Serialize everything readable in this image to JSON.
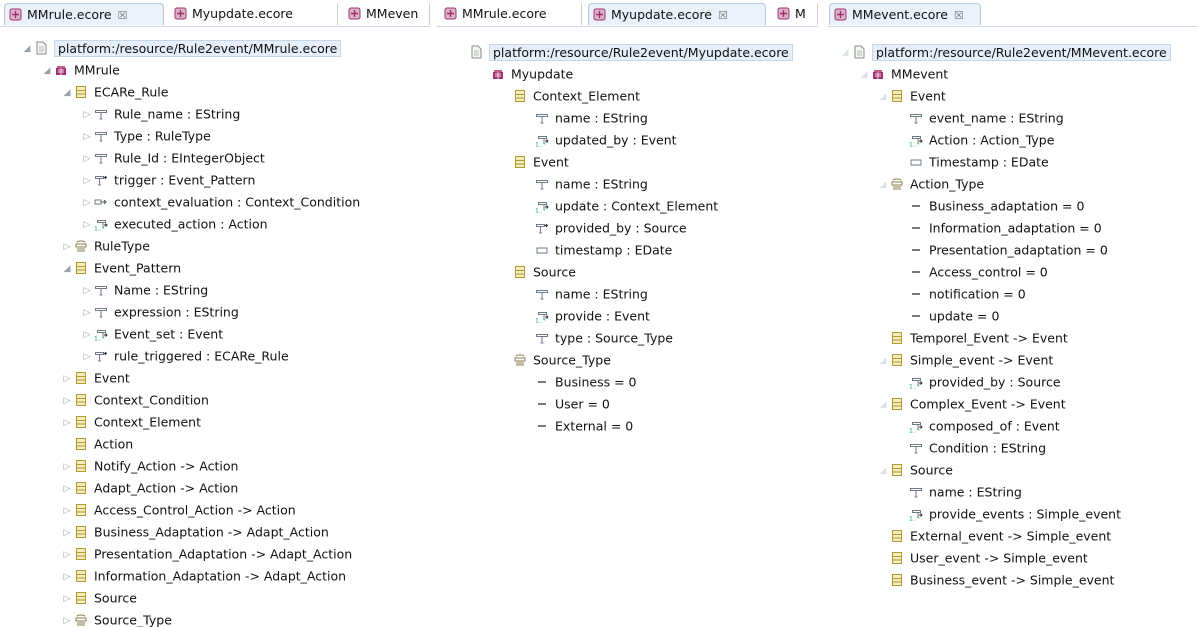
{
  "colors": {
    "package": "#a03070",
    "class": "#b09a30",
    "attr": "#6c7a8a",
    "enum": "#8a7d4d"
  },
  "pane1": {
    "tabs": [
      {
        "label": "MMrule.ecore",
        "close": "☒",
        "active": true
      },
      {
        "label": "Myupdate.ecore",
        "close": "",
        "active": false
      },
      {
        "label": "MMeven",
        "close": "",
        "active": false
      }
    ],
    "rows": [
      {
        "text": "platform:/resource/Rule2event/MMrule.ecore",
        "icon": "resource-file-icon",
        "tw": "open",
        "level": 0
      },
      {
        "text": "MMrule",
        "icon": "package-icon",
        "tw": "open",
        "level": 1
      },
      {
        "text": "ECARe_Rule",
        "icon": "eclass-icon",
        "tw": "open",
        "level": 2
      },
      {
        "text": "Rule_name : EString",
        "icon": "attribute-icon",
        "tw": "closed",
        "level": 3
      },
      {
        "text": "Type : RuleType",
        "icon": "attribute-icon",
        "tw": "closed",
        "level": 3
      },
      {
        "text": "Rule_Id : EIntegerObject",
        "icon": "attribute-icon",
        "tw": "closed",
        "level": 3
      },
      {
        "text": "trigger : Event_Pattern",
        "icon": "reference-icon",
        "tw": "closed",
        "level": 3
      },
      {
        "text": "context_evaluation : Context_Condition",
        "icon": "containment-icon",
        "tw": "closed",
        "level": 3
      },
      {
        "text": "executed_action : Action",
        "icon": "many-reference-icon",
        "tw": "closed",
        "level": 3
      },
      {
        "text": "RuleType",
        "icon": "enum-icon",
        "tw": "closed",
        "level": 2
      },
      {
        "text": "Event_Pattern",
        "icon": "eclass-icon",
        "tw": "open",
        "level": 2
      },
      {
        "text": "Name : EString",
        "icon": "attribute-icon",
        "tw": "closed",
        "level": 3
      },
      {
        "text": "expression : EString",
        "icon": "attribute-icon",
        "tw": "closed",
        "level": 3
      },
      {
        "text": "Event_set : Event",
        "icon": "many-reference-icon",
        "tw": "closed",
        "level": 3
      },
      {
        "text": "rule_triggered : ECARe_Rule",
        "icon": "reference-icon",
        "tw": "closed",
        "level": 3
      },
      {
        "text": "Event",
        "icon": "eclass-icon",
        "tw": "closed",
        "level": 2
      },
      {
        "text": "Context_Condition",
        "icon": "eclass-icon",
        "tw": "closed",
        "level": 2
      },
      {
        "text": "Context_Element",
        "icon": "eclass-icon",
        "tw": "closed",
        "level": 2
      },
      {
        "text": "Action",
        "icon": "eclass-icon",
        "tw": "none",
        "level": 2
      },
      {
        "text": "Notify_Action -> Action",
        "icon": "eclass-icon",
        "tw": "closed",
        "level": 2
      },
      {
        "text": "Adapt_Action -> Action",
        "icon": "eclass-icon",
        "tw": "closed",
        "level": 2
      },
      {
        "text": "Access_Control_Action -> Action",
        "icon": "eclass-icon",
        "tw": "closed",
        "level": 2
      },
      {
        "text": "Business_Adaptation -> Adapt_Action",
        "icon": "eclass-icon",
        "tw": "closed",
        "level": 2
      },
      {
        "text": "Presentation_Adaptation -> Adapt_Action",
        "icon": "eclass-icon",
        "tw": "closed",
        "level": 2
      },
      {
        "text": "Information_Adaptation -> Adapt_Action",
        "icon": "eclass-icon",
        "tw": "closed",
        "level": 2
      },
      {
        "text": "Source",
        "icon": "eclass-icon",
        "tw": "closed",
        "level": 2
      },
      {
        "text": "Source_Type",
        "icon": "enum-icon",
        "tw": "closed",
        "level": 2
      }
    ]
  },
  "pane2": {
    "tabs": [
      {
        "label": "MMrule.ecore",
        "close": "",
        "active": false
      },
      {
        "label": "Myupdate.ecore",
        "close": "☒",
        "active": true
      },
      {
        "label": "M",
        "close": "",
        "active": false
      }
    ],
    "rows": [
      {
        "text": "platform:/resource/Rule2event/Myupdate.ecore",
        "icon": "resource-file-icon",
        "tw": "none",
        "level": 0
      },
      {
        "text": "Myupdate",
        "icon": "package-icon",
        "tw": "none",
        "level": 1
      },
      {
        "text": "Context_Element",
        "icon": "eclass-icon",
        "tw": "none",
        "level": 2
      },
      {
        "text": "name : EString",
        "icon": "attribute-icon",
        "tw": "none",
        "level": 3
      },
      {
        "text": "updated_by : Event",
        "icon": "many-reference-icon",
        "tw": "none",
        "level": 3
      },
      {
        "text": "Event",
        "icon": "eclass-icon",
        "tw": "none",
        "level": 2
      },
      {
        "text": "name : EString",
        "icon": "attribute-icon",
        "tw": "none",
        "level": 3
      },
      {
        "text": "update : Context_Element",
        "icon": "many-reference-icon",
        "tw": "none",
        "level": 3
      },
      {
        "text": "provided_by : Source",
        "icon": "reference-icon",
        "tw": "none",
        "level": 3
      },
      {
        "text": "timestamp : EDate",
        "icon": "plain-attribute-icon",
        "tw": "none",
        "level": 3
      },
      {
        "text": "Source",
        "icon": "eclass-icon",
        "tw": "none",
        "level": 2
      },
      {
        "text": "name : EString",
        "icon": "attribute-icon",
        "tw": "none",
        "level": 3
      },
      {
        "text": "provide : Event",
        "icon": "many-reference-icon",
        "tw": "none",
        "level": 3
      },
      {
        "text": "type : Source_Type",
        "icon": "attribute-icon",
        "tw": "none",
        "level": 3
      },
      {
        "text": "Source_Type",
        "icon": "enum-icon",
        "tw": "none",
        "level": 2
      },
      {
        "text": "Business = 0",
        "icon": "literal-icon",
        "tw": "none",
        "level": 3
      },
      {
        "text": "User = 0",
        "icon": "literal-icon",
        "tw": "none",
        "level": 3
      },
      {
        "text": "External = 0",
        "icon": "literal-icon",
        "tw": "none",
        "level": 3
      }
    ]
  },
  "pane3": {
    "tabs": [
      {
        "label": "MMevent.ecore",
        "close": "☒",
        "active": true
      }
    ],
    "rows": [
      {
        "text": "platform:/resource/Rule2event/MMevent.ecore",
        "icon": "resource-file-icon",
        "tw": "faint",
        "level": 0
      },
      {
        "text": "MMevent",
        "icon": "package-icon",
        "tw": "faint",
        "level": 1
      },
      {
        "text": "Event",
        "icon": "eclass-icon",
        "tw": "faint",
        "level": 2
      },
      {
        "text": "event_name : EString",
        "icon": "attribute-icon",
        "tw": "none",
        "level": 3
      },
      {
        "text": "Action : Action_Type",
        "icon": "many-reference-icon",
        "tw": "none",
        "level": 3
      },
      {
        "text": "Timestamp : EDate",
        "icon": "plain-attribute-icon",
        "tw": "none",
        "level": 3
      },
      {
        "text": "Action_Type",
        "icon": "enum-icon",
        "tw": "faint",
        "level": 2
      },
      {
        "text": "Business_adaptation = 0",
        "icon": "literal-icon",
        "tw": "none",
        "level": 3
      },
      {
        "text": "Information_adaptation = 0",
        "icon": "literal-icon",
        "tw": "none",
        "level": 3
      },
      {
        "text": "Presentation_adaptation = 0",
        "icon": "literal-icon",
        "tw": "none",
        "level": 3
      },
      {
        "text": "Access_control = 0",
        "icon": "literal-icon",
        "tw": "none",
        "level": 3
      },
      {
        "text": "notification = 0",
        "icon": "literal-icon",
        "tw": "none",
        "level": 3
      },
      {
        "text": "update = 0",
        "icon": "literal-icon",
        "tw": "none",
        "level": 3
      },
      {
        "text": "Temporel_Event -> Event",
        "icon": "eclass-icon",
        "tw": "none",
        "level": 2
      },
      {
        "text": "Simple_event -> Event",
        "icon": "eclass-icon",
        "tw": "faint",
        "level": 2
      },
      {
        "text": "provided_by : Source",
        "icon": "many-reference-icon",
        "tw": "none",
        "level": 3
      },
      {
        "text": "Complex_Event -> Event",
        "icon": "eclass-icon",
        "tw": "faint",
        "level": 2
      },
      {
        "text": "composed_of : Event",
        "icon": "many-reference-icon",
        "tw": "none",
        "level": 3
      },
      {
        "text": "Condition : EString",
        "icon": "attribute-icon",
        "tw": "none",
        "level": 3
      },
      {
        "text": "Source",
        "icon": "eclass-icon",
        "tw": "faint",
        "level": 2
      },
      {
        "text": "name : EString",
        "icon": "attribute-icon",
        "tw": "none",
        "level": 3
      },
      {
        "text": "provide_events : Simple_event",
        "icon": "many-reference-icon",
        "tw": "none",
        "level": 3
      },
      {
        "text": "External_event -> Simple_event",
        "icon": "eclass-icon",
        "tw": "none",
        "level": 2
      },
      {
        "text": "User_event -> Simple_event",
        "icon": "eclass-icon",
        "tw": "none",
        "level": 2
      },
      {
        "text": "Business_event -> Simple_event",
        "icon": "eclass-icon",
        "tw": "none",
        "level": 2
      }
    ]
  }
}
